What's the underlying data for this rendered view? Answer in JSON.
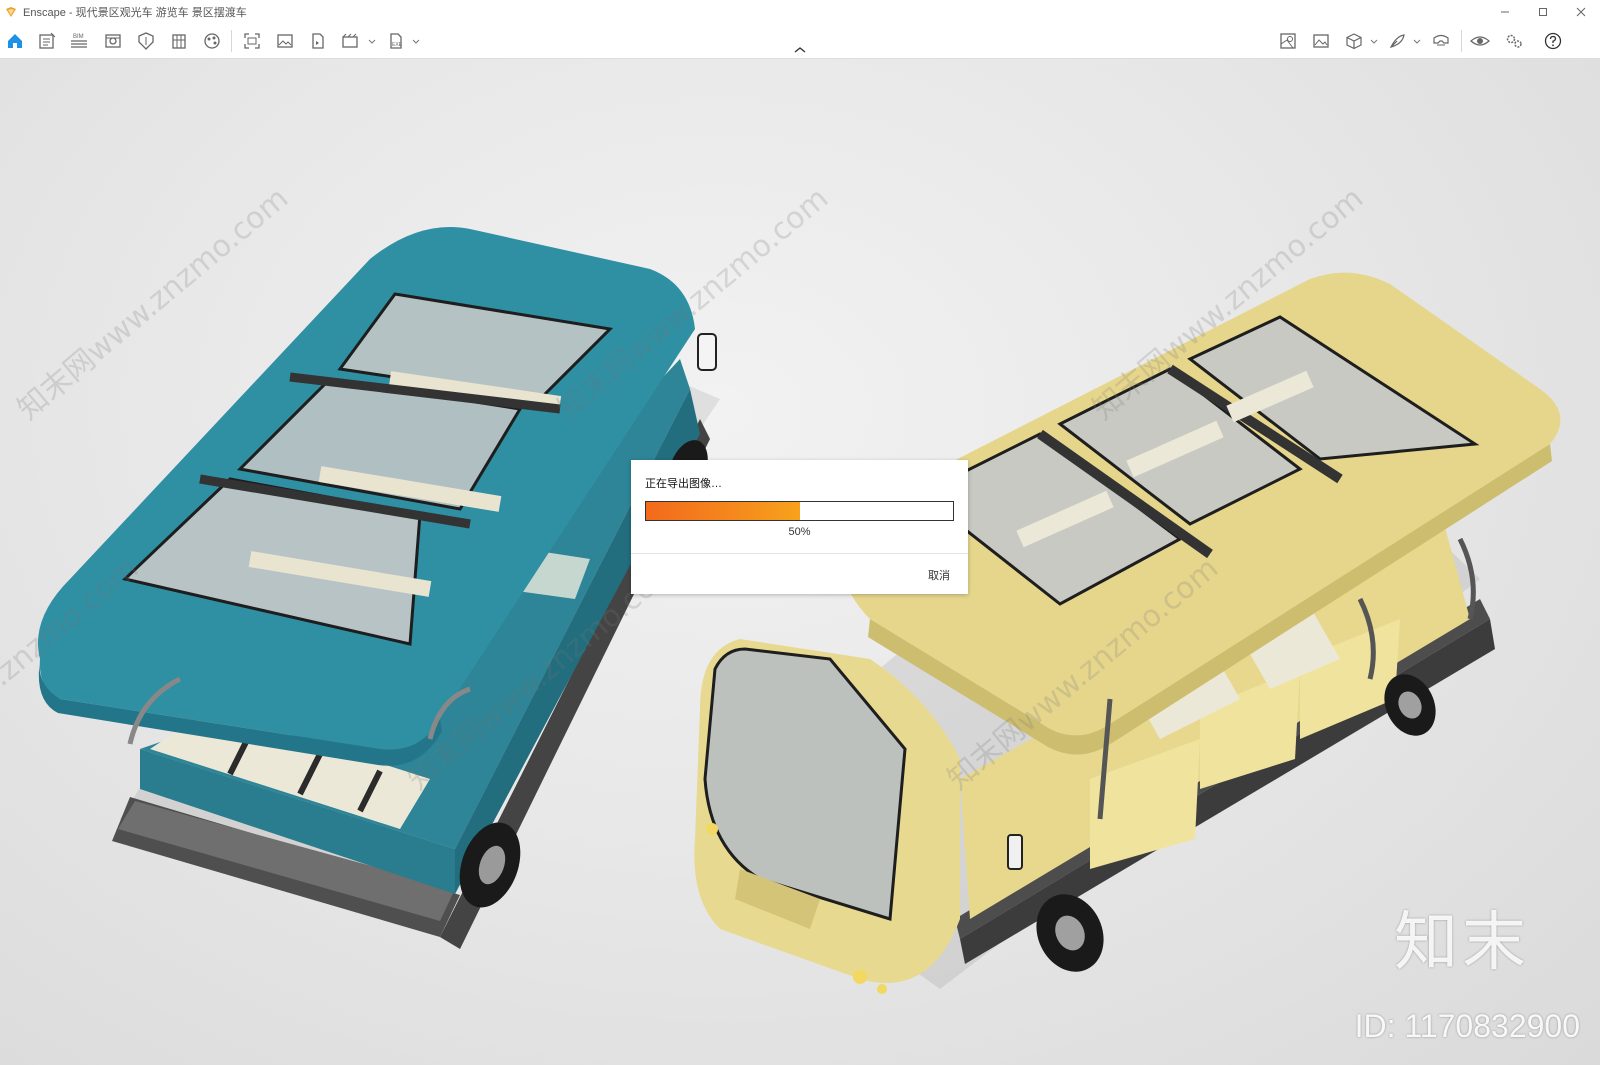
{
  "window": {
    "title": "Enscape - 现代景区观光车 游览车 景区摆渡车",
    "controls": [
      "minimize",
      "maximize",
      "close"
    ]
  },
  "toolbar": {
    "left_icons": [
      "home-icon",
      "asset-library-icon",
      "bim-icon",
      "visual-settings-icon",
      "section-icon",
      "building-icon",
      "material-icon",
      "screenshot-icon",
      "render-image-icon",
      "batch-render-icon",
      "video-icon",
      "export-icon"
    ],
    "bim_label": "BIM",
    "exe_label": "EXE",
    "right_icons": [
      "map-icon",
      "image-icon",
      "cube-icon",
      "feather-icon",
      "vr-headset-icon",
      "eye-icon",
      "settings-icon",
      "help-icon"
    ],
    "accent_color": "#1e90e6"
  },
  "dialog": {
    "title": "正在导出图像…",
    "progress": 0.5,
    "percent_text": "50%",
    "cancel_label": "取消",
    "progress_colors": [
      "#f26a1c",
      "#f7a21c"
    ]
  },
  "watermarks": {
    "diagonal": [
      "知末网www.znzmo.com",
      "知末网www.znzmo.com",
      "知末网www.znzmo.com",
      "知末网www.znzmo.com",
      "知末网www.znzmo.com",
      "知末网www.znzmo.com"
    ],
    "logo": "知末",
    "id": "ID: 1170832900"
  },
  "scene": {
    "objects": [
      "teal-sightseeing-cart",
      "yellow-sightseeing-cart"
    ],
    "colors": {
      "teal": "#2f8fa3",
      "yellow": "#e6d68c"
    }
  }
}
